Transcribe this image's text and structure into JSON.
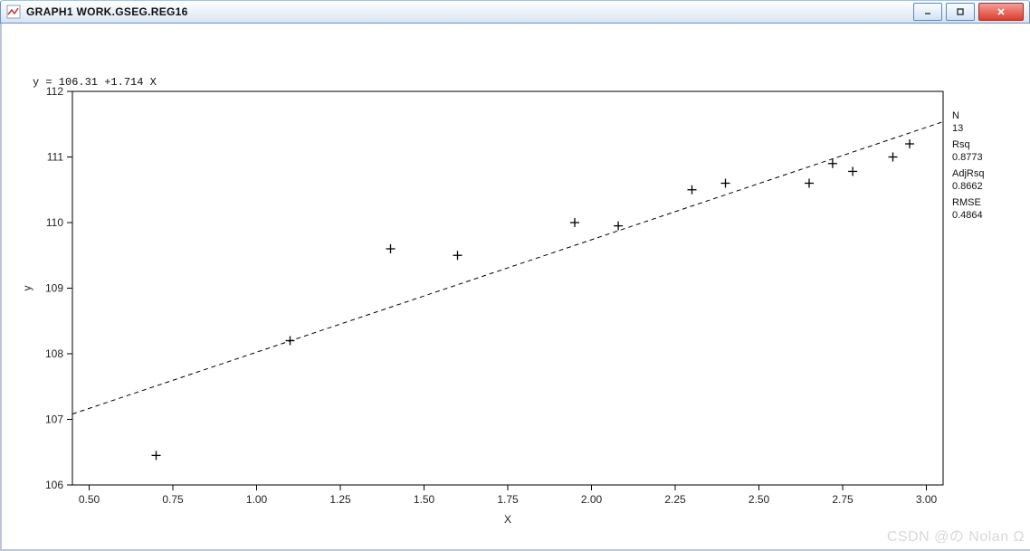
{
  "window": {
    "title": "GRAPH1   WORK.GSEG.REG16"
  },
  "chart_data": {
    "type": "scatter",
    "equation": "y = 106.31 +1.714 X",
    "xlabel": "X",
    "ylabel": "y",
    "xlim": [
      0.45,
      3.05
    ],
    "ylim": [
      106,
      112
    ],
    "x_ticks": [
      0.5,
      0.75,
      1.0,
      1.25,
      1.5,
      1.75,
      2.0,
      2.25,
      2.5,
      2.75,
      3.0
    ],
    "y_ticks": [
      106,
      107,
      108,
      109,
      110,
      111,
      112
    ],
    "points": [
      {
        "x": 0.7,
        "y": 106.45
      },
      {
        "x": 1.1,
        "y": 108.2
      },
      {
        "x": 1.4,
        "y": 109.6
      },
      {
        "x": 1.6,
        "y": 109.5
      },
      {
        "x": 1.95,
        "y": 110.0
      },
      {
        "x": 2.08,
        "y": 109.95
      },
      {
        "x": 2.3,
        "y": 110.5
      },
      {
        "x": 2.4,
        "y": 110.6
      },
      {
        "x": 2.65,
        "y": 110.6
      },
      {
        "x": 2.72,
        "y": 110.9
      },
      {
        "x": 2.78,
        "y": 110.78
      },
      {
        "x": 2.9,
        "y": 111.0
      },
      {
        "x": 2.95,
        "y": 111.2
      }
    ],
    "regression": {
      "intercept": 106.31,
      "slope": 1.714
    },
    "stats": {
      "N_label": "N",
      "N_value": "13",
      "Rsq_label": "Rsq",
      "Rsq_value": "0.8773",
      "AdjRsq_label": "AdjRsq",
      "AdjRsq_value": "0.8662",
      "RMSE_label": "RMSE",
      "RMSE_value": "0.4864"
    }
  },
  "watermark": "CSDN @の  Nolan  Ω"
}
